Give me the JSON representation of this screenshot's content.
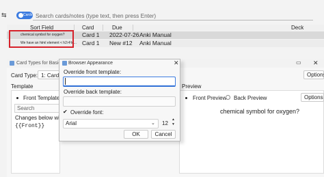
{
  "browser": {
    "toggle_label": "Cards",
    "search_placeholder": "Search cards/notes (type text, then press Enter)",
    "columns": [
      "Sort Field",
      "Card",
      "Due",
      "Deck"
    ],
    "rows": [
      {
        "sort_field": "chemical symbol for oxygen?",
        "card": "Card 1",
        "due": "2022-07-26",
        "deck": "Anki Manual"
      },
      {
        "sort_field": "We have an html element < h2>Flo...",
        "card": "Card 1",
        "due": "New #12",
        "deck": "Anki Manual"
      }
    ],
    "accent_color": "#3b7be0",
    "highlight_color": "#d6202a"
  },
  "card_types": {
    "title": "Card Types for Basic",
    "card_type_label": "Card Type:",
    "card_type_value": "1: Card",
    "template_label": "Template",
    "preview_label": "Preview",
    "options_label": "Options",
    "front_template_label": "Front Template",
    "search_placeholder": "Search",
    "changes_text": "Changes below will",
    "front_field": "{{Front}}",
    "front_preview_label": "Front Preview",
    "back_preview_label": "Back Preview",
    "preview_options_label": "Options",
    "preview_text": "chemical symbol for oxygen?"
  },
  "dialog": {
    "title": "Browser Appearance",
    "front_template_label": "Override front template:",
    "front_template_value": "",
    "back_template_label": "Override back template:",
    "back_template_value": "",
    "override_font_label": "Override font:",
    "override_font_checked": true,
    "font_value": "Arial",
    "font_size": "12",
    "ok_label": "OK",
    "cancel_label": "Cancel"
  }
}
